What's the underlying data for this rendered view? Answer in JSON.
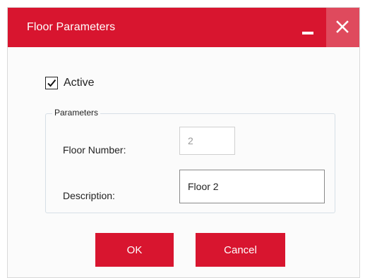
{
  "dialog": {
    "title": "Floor Parameters",
    "accent_color": "#d8152f",
    "close_hover_color": "#df4a5d",
    "minimize_icon": "minimize-icon",
    "close_icon": "close-icon"
  },
  "active": {
    "label": "Active",
    "checked": true
  },
  "parameters": {
    "legend": "Parameters",
    "floor_number_label": "Floor Number:",
    "floor_number_value": "2",
    "description_label": "Description:",
    "description_value": "Floor 2"
  },
  "buttons": {
    "ok_label": "OK",
    "cancel_label": "Cancel"
  }
}
